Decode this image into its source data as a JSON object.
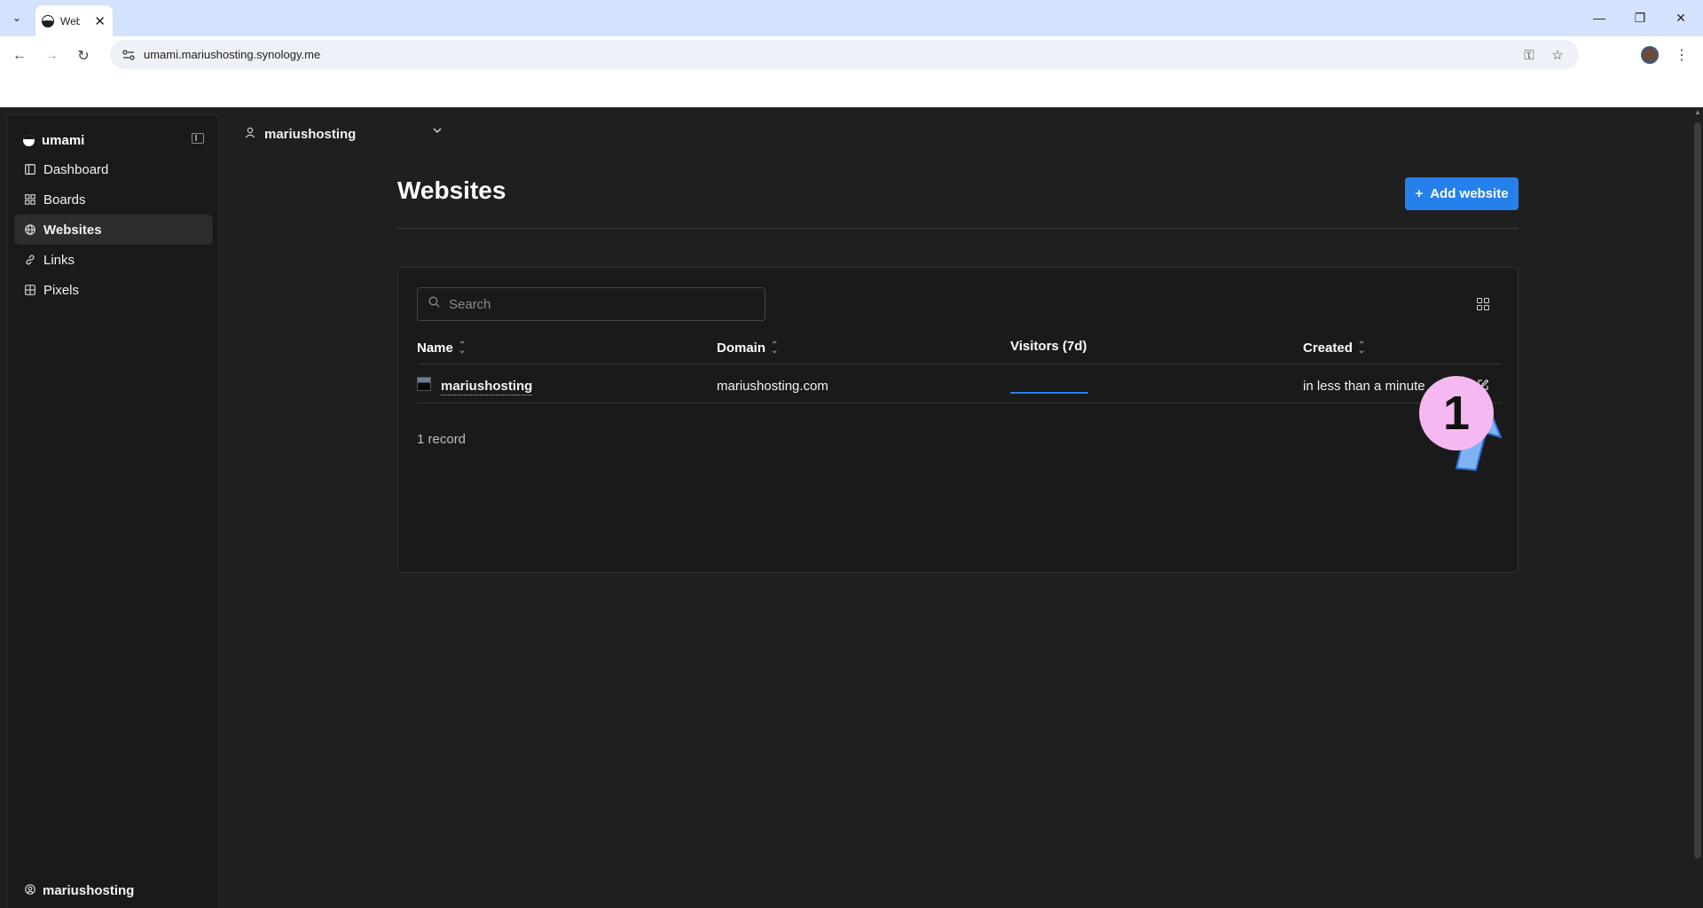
{
  "browser": {
    "tab_title": "Websites",
    "tab_close": "✕",
    "url": "umami.mariushosting.synology.me"
  },
  "sidebar": {
    "brand": "umami",
    "items": [
      {
        "label": "Dashboard",
        "icon": "dashboard-icon"
      },
      {
        "label": "Boards",
        "icon": "boards-icon"
      },
      {
        "label": "Websites",
        "icon": "globe-icon",
        "active": true
      },
      {
        "label": "Links",
        "icon": "link-icon"
      },
      {
        "label": "Pixels",
        "icon": "pixels-icon"
      }
    ],
    "user": "mariushosting"
  },
  "header": {
    "team": "mariushosting"
  },
  "main": {
    "title": "Websites",
    "add_button": "Add website",
    "search_placeholder": "Search",
    "columns": [
      "Name",
      "Domain",
      "Visitors (7d)",
      "Created"
    ],
    "rows": [
      {
        "name": "mariushosting",
        "domain": "mariushosting.com",
        "created": "in less than a minute"
      }
    ],
    "record_count": "1 record"
  },
  "annotation": {
    "step": "1"
  },
  "colors": {
    "accent": "#2680eb",
    "callout": "#f6b8f0",
    "arrow": "#7fb2f5"
  }
}
